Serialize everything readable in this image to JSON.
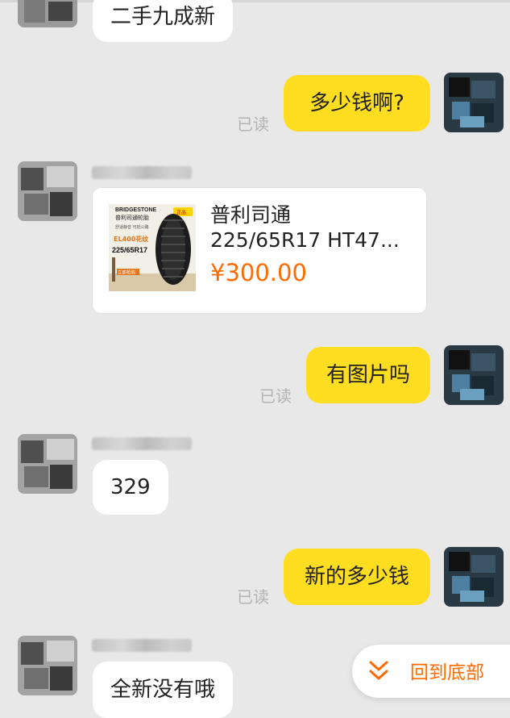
{
  "messages": {
    "m1": {
      "text": "二手九成新"
    },
    "m2": {
      "text": "多少钱啊?",
      "status": "已读"
    },
    "m4": {
      "text": "有图片吗",
      "status": "已读"
    },
    "m5": {
      "text": "329"
    },
    "m6": {
      "text": "新的多少钱",
      "status": "已读"
    },
    "m7": {
      "text": "全新没有哦"
    }
  },
  "product_card": {
    "title_line1": "普利司通",
    "title_line2": "225/65R17 HT47...",
    "price": "¥300.00",
    "image_brand": "BRIDGESTONE",
    "image_subtitle": "普利司通轮胎",
    "image_model": "EL400花纹",
    "image_size": "225/65R17",
    "image_badge": "正品",
    "image_button": "立即抢购",
    "image_tagline": "舒适静音 可抵公路"
  },
  "back_to_bottom": {
    "label": "回到底部"
  },
  "colors": {
    "bubble_out": "#ffdd20",
    "price": "#ff6a00",
    "background": "#e8e8e8"
  }
}
